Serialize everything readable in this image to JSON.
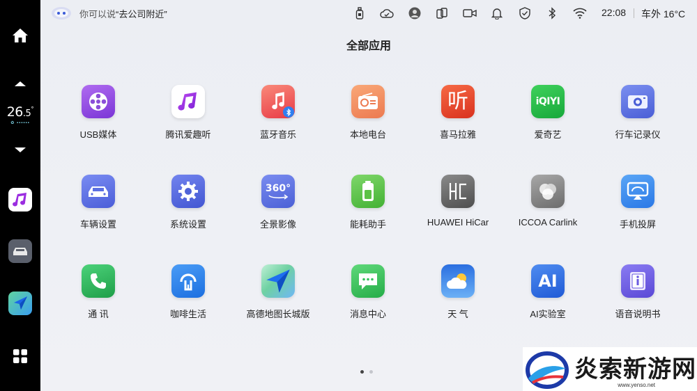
{
  "statusbar": {
    "hint_prefix": "你可以说",
    "hint_query": "“去公司附近”",
    "time": "22:08",
    "outside_temp": "车外 16°C"
  },
  "sidebar": {
    "temp_main": "26",
    "temp_decimal": ".5",
    "temp_unit": "°",
    "fan_dots": "✿ ▪▪▪▪▪▪"
  },
  "page": {
    "title": "全部应用"
  },
  "apps": [
    {
      "label": "USB媒体",
      "icon": "usb-media-icon",
      "color": "#8b4fd8"
    },
    {
      "label": "腾讯爱趣听",
      "icon": "tencent-music-icon",
      "color": "#ffffff"
    },
    {
      "label": "蓝牙音乐",
      "icon": "bluetooth-music-icon",
      "color": "#f0564e"
    },
    {
      "label": "本地电台",
      "icon": "radio-icon",
      "color": "#f08a5a"
    },
    {
      "label": "喜马拉雅",
      "icon": "ximalaya-icon",
      "color": "#e8402c"
    },
    {
      "label": "爱奇艺",
      "icon": "iqiyi-icon",
      "color": "#2bbd4a"
    },
    {
      "label": "行车记录仪",
      "icon": "dashcam-icon",
      "color": "#5a72e0"
    },
    {
      "label": "车辆设置",
      "icon": "car-settings-icon",
      "color": "#5b6fe2"
    },
    {
      "label": "系统设置",
      "icon": "system-settings-icon",
      "color": "#4f63d8"
    },
    {
      "label": "全景影像",
      "icon": "panorama-360-icon",
      "color": "#5570de"
    },
    {
      "label": "能耗助手",
      "icon": "battery-icon",
      "color": "#5cc246"
    },
    {
      "label": "HUAWEI HiCar",
      "icon": "hicar-icon",
      "color": "#6a6a6a"
    },
    {
      "label": "ICCOA Carlink",
      "icon": "carlink-icon",
      "color": "#8a8a8a"
    },
    {
      "label": "手机投屏",
      "icon": "screen-cast-icon",
      "color": "#3a8ef0"
    },
    {
      "label": "通  讯",
      "icon": "phone-icon",
      "color": "#2fb45a"
    },
    {
      "label": "咖啡生活",
      "icon": "coffee-life-icon",
      "color": "#2a82ee"
    },
    {
      "label": "高德地图长城版",
      "icon": "amap-icon",
      "color": "#2a7bf0"
    },
    {
      "label": "消息中心",
      "icon": "message-center-icon",
      "color": "#34c35c"
    },
    {
      "label": "天  气",
      "icon": "weather-icon",
      "color": "#3a8de8"
    },
    {
      "label": "AI实验室",
      "icon": "ai-lab-icon",
      "color": "#2f6ee0"
    },
    {
      "label": "语音说明书",
      "icon": "voice-manual-icon",
      "color": "#6a5ae0"
    }
  ],
  "watermark": {
    "text": "炎索新游网",
    "url": "www.yenso.net"
  }
}
